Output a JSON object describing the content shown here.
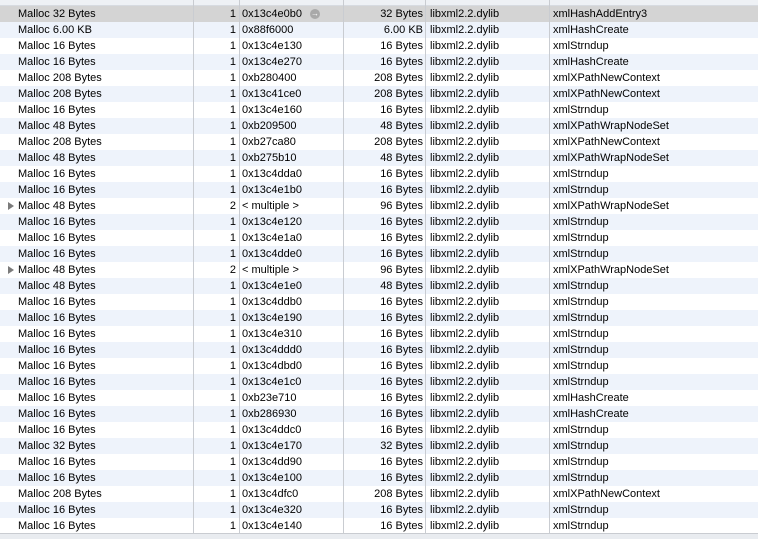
{
  "rows": [
    {
      "category": "Malloc 32 Bytes",
      "count": "1",
      "address": "0x13c4e0b0",
      "size": "32 Bytes",
      "library": "libxml2.2.dylib",
      "function": "xmlHashAddEntry3",
      "selected": true
    },
    {
      "category": "Malloc 6.00 KB",
      "count": "1",
      "address": "0x88f6000",
      "size": "6.00 KB",
      "library": "libxml2.2.dylib",
      "function": "xmlHashCreate"
    },
    {
      "category": "Malloc 16 Bytes",
      "count": "1",
      "address": "0x13c4e130",
      "size": "16 Bytes",
      "library": "libxml2.2.dylib",
      "function": "xmlStrndup"
    },
    {
      "category": "Malloc 16 Bytes",
      "count": "1",
      "address": "0x13c4e270",
      "size": "16 Bytes",
      "library": "libxml2.2.dylib",
      "function": "xmlHashCreate"
    },
    {
      "category": "Malloc 208 Bytes",
      "count": "1",
      "address": "0xb280400",
      "size": "208 Bytes",
      "library": "libxml2.2.dylib",
      "function": "xmlXPathNewContext"
    },
    {
      "category": "Malloc 208 Bytes",
      "count": "1",
      "address": "0x13c41ce0",
      "size": "208 Bytes",
      "library": "libxml2.2.dylib",
      "function": "xmlXPathNewContext"
    },
    {
      "category": "Malloc 16 Bytes",
      "count": "1",
      "address": "0x13c4e160",
      "size": "16 Bytes",
      "library": "libxml2.2.dylib",
      "function": "xmlStrndup"
    },
    {
      "category": "Malloc 48 Bytes",
      "count": "1",
      "address": "0xb209500",
      "size": "48 Bytes",
      "library": "libxml2.2.dylib",
      "function": "xmlXPathWrapNodeSet"
    },
    {
      "category": "Malloc 208 Bytes",
      "count": "1",
      "address": "0xb27ca80",
      "size": "208 Bytes",
      "library": "libxml2.2.dylib",
      "function": "xmlXPathNewContext"
    },
    {
      "category": "Malloc 48 Bytes",
      "count": "1",
      "address": "0xb275b10",
      "size": "48 Bytes",
      "library": "libxml2.2.dylib",
      "function": "xmlXPathWrapNodeSet"
    },
    {
      "category": "Malloc 16 Bytes",
      "count": "1",
      "address": "0x13c4dda0",
      "size": "16 Bytes",
      "library": "libxml2.2.dylib",
      "function": "xmlStrndup"
    },
    {
      "category": "Malloc 16 Bytes",
      "count": "1",
      "address": "0x13c4e1b0",
      "size": "16 Bytes",
      "library": "libxml2.2.dylib",
      "function": "xmlStrndup"
    },
    {
      "category": "Malloc 48 Bytes",
      "count": "2",
      "address": "< multiple >",
      "size": "96 Bytes",
      "library": "libxml2.2.dylib",
      "function": "xmlXPathWrapNodeSet",
      "expandable": true
    },
    {
      "category": "Malloc 16 Bytes",
      "count": "1",
      "address": "0x13c4e120",
      "size": "16 Bytes",
      "library": "libxml2.2.dylib",
      "function": "xmlStrndup"
    },
    {
      "category": "Malloc 16 Bytes",
      "count": "1",
      "address": "0x13c4e1a0",
      "size": "16 Bytes",
      "library": "libxml2.2.dylib",
      "function": "xmlStrndup"
    },
    {
      "category": "Malloc 16 Bytes",
      "count": "1",
      "address": "0x13c4dde0",
      "size": "16 Bytes",
      "library": "libxml2.2.dylib",
      "function": "xmlStrndup"
    },
    {
      "category": "Malloc 48 Bytes",
      "count": "2",
      "address": "< multiple >",
      "size": "96 Bytes",
      "library": "libxml2.2.dylib",
      "function": "xmlXPathWrapNodeSet",
      "expandable": true
    },
    {
      "category": "Malloc 48 Bytes",
      "count": "1",
      "address": "0x13c4e1e0",
      "size": "48 Bytes",
      "library": "libxml2.2.dylib",
      "function": "xmlStrndup"
    },
    {
      "category": "Malloc 16 Bytes",
      "count": "1",
      "address": "0x13c4ddb0",
      "size": "16 Bytes",
      "library": "libxml2.2.dylib",
      "function": "xmlStrndup"
    },
    {
      "category": "Malloc 16 Bytes",
      "count": "1",
      "address": "0x13c4e190",
      "size": "16 Bytes",
      "library": "libxml2.2.dylib",
      "function": "xmlStrndup"
    },
    {
      "category": "Malloc 16 Bytes",
      "count": "1",
      "address": "0x13c4e310",
      "size": "16 Bytes",
      "library": "libxml2.2.dylib",
      "function": "xmlStrndup"
    },
    {
      "category": "Malloc 16 Bytes",
      "count": "1",
      "address": "0x13c4ddd0",
      "size": "16 Bytes",
      "library": "libxml2.2.dylib",
      "function": "xmlStrndup"
    },
    {
      "category": "Malloc 16 Bytes",
      "count": "1",
      "address": "0x13c4dbd0",
      "size": "16 Bytes",
      "library": "libxml2.2.dylib",
      "function": "xmlStrndup"
    },
    {
      "category": "Malloc 16 Bytes",
      "count": "1",
      "address": "0x13c4e1c0",
      "size": "16 Bytes",
      "library": "libxml2.2.dylib",
      "function": "xmlStrndup"
    },
    {
      "category": "Malloc 16 Bytes",
      "count": "1",
      "address": "0xb23e710",
      "size": "16 Bytes",
      "library": "libxml2.2.dylib",
      "function": "xmlHashCreate"
    },
    {
      "category": "Malloc 16 Bytes",
      "count": "1",
      "address": "0xb286930",
      "size": "16 Bytes",
      "library": "libxml2.2.dylib",
      "function": "xmlHashCreate"
    },
    {
      "category": "Malloc 16 Bytes",
      "count": "1",
      "address": "0x13c4ddc0",
      "size": "16 Bytes",
      "library": "libxml2.2.dylib",
      "function": "xmlStrndup"
    },
    {
      "category": "Malloc 32 Bytes",
      "count": "1",
      "address": "0x13c4e170",
      "size": "32 Bytes",
      "library": "libxml2.2.dylib",
      "function": "xmlStrndup"
    },
    {
      "category": "Malloc 16 Bytes",
      "count": "1",
      "address": "0x13c4dd90",
      "size": "16 Bytes",
      "library": "libxml2.2.dylib",
      "function": "xmlStrndup"
    },
    {
      "category": "Malloc 16 Bytes",
      "count": "1",
      "address": "0x13c4e100",
      "size": "16 Bytes",
      "library": "libxml2.2.dylib",
      "function": "xmlStrndup"
    },
    {
      "category": "Malloc 208 Bytes",
      "count": "1",
      "address": "0x13c4dfc0",
      "size": "208 Bytes",
      "library": "libxml2.2.dylib",
      "function": "xmlXPathNewContext"
    },
    {
      "category": "Malloc 16 Bytes",
      "count": "1",
      "address": "0x13c4e320",
      "size": "16 Bytes",
      "library": "libxml2.2.dylib",
      "function": "xmlStrndup"
    },
    {
      "category": "Malloc 16 Bytes",
      "count": "1",
      "address": "0x13c4e140",
      "size": "16 Bytes",
      "library": "libxml2.2.dylib",
      "function": "xmlStrndup"
    }
  ],
  "icons": {
    "address_follow": "arrow-right-circle-icon",
    "disclosure": "disclosure-triangle-icon"
  },
  "colors": {
    "row_alt": "#eef3fb",
    "row_selected": "#d4d4d4",
    "grid": "#c9ccd1"
  }
}
